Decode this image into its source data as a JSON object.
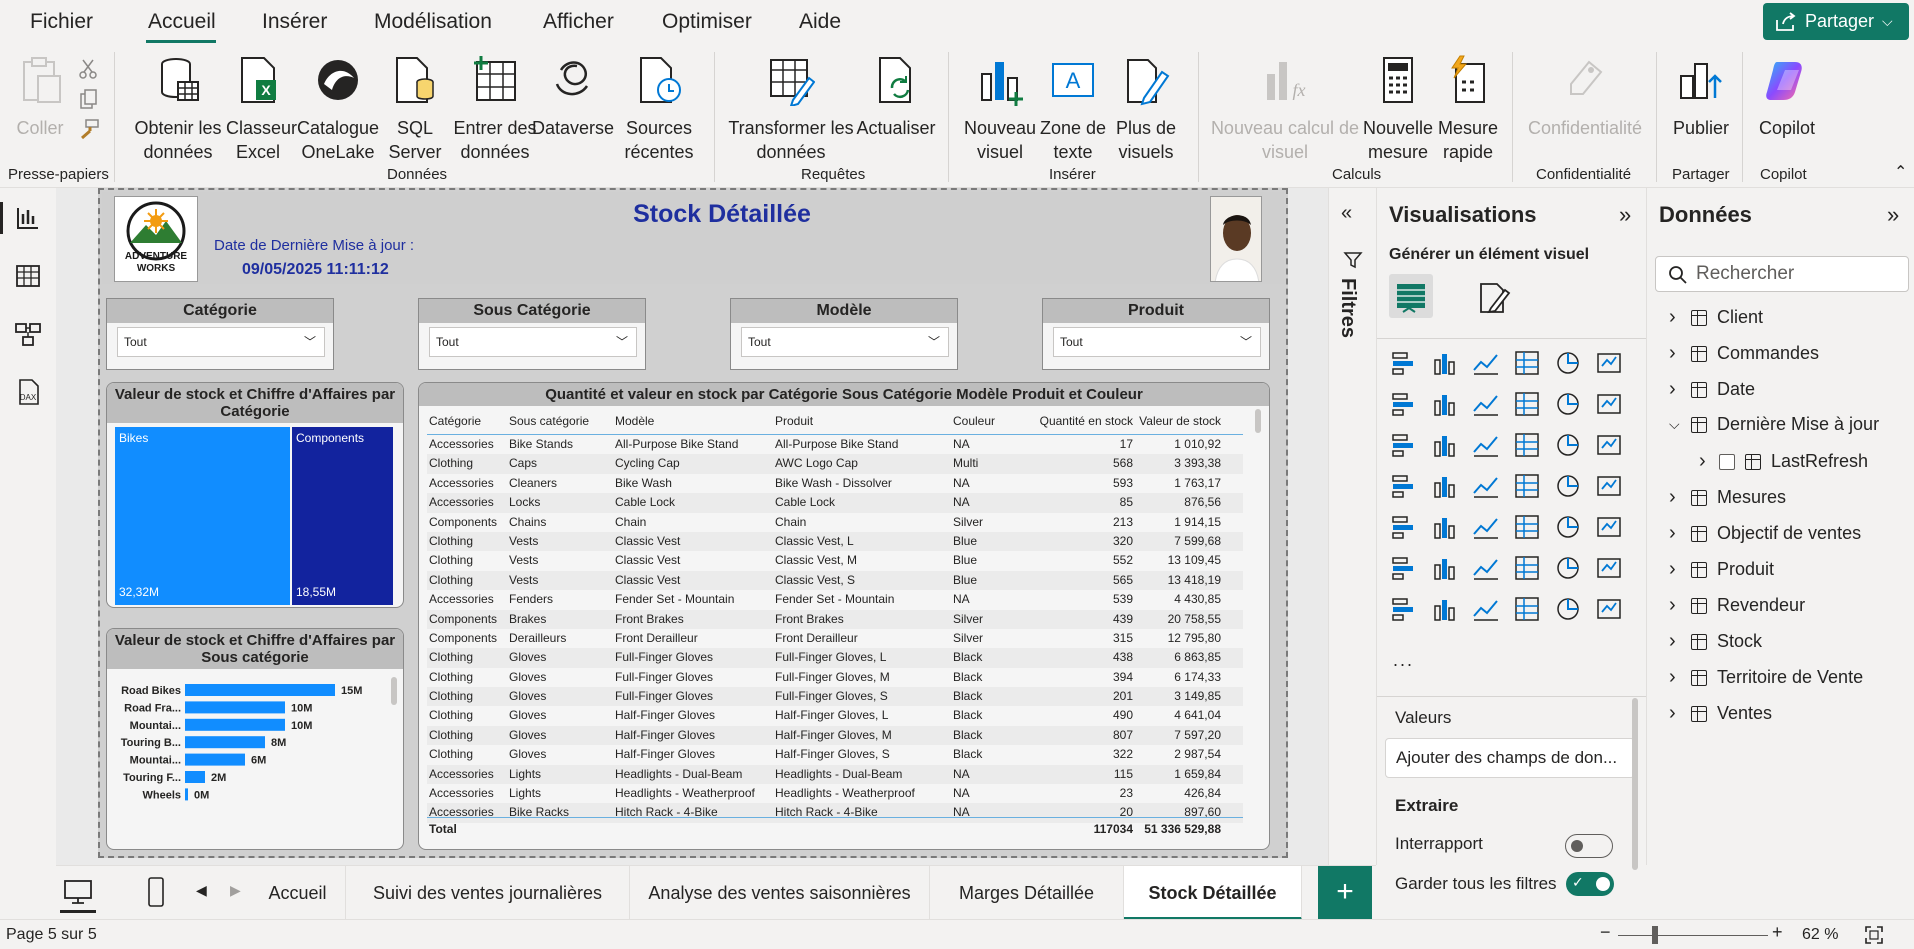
{
  "menu": {
    "items": [
      "Fichier",
      "Accueil",
      "Insérer",
      "Modélisation",
      "Afficher",
      "Optimiser",
      "Aide"
    ],
    "active": "Accueil",
    "share_label": "Partager"
  },
  "ribbon": {
    "clipboard": {
      "paste_label": "Coller",
      "group_label": "Presse-papiers"
    },
    "data": {
      "get_data_label": "Obtenir les données",
      "excel_label": "Classeur Excel",
      "onelake_label": "Catalogue OneLake",
      "sql_label": "SQL Server",
      "enter_data_label": "Entrer des données",
      "dataverse_label": "Dataverse",
      "recent_label": "Sources récentes",
      "group_label": "Données"
    },
    "queries": {
      "transform_label": "Transformer les données",
      "refresh_label": "Actualiser",
      "group_label": "Requêtes"
    },
    "insert": {
      "new_visual_label": "Nouveau visuel",
      "textbox_label": "Zone de texte",
      "more_visuals_label": "Plus de visuels",
      "group_label": "Insérer"
    },
    "calculations": {
      "new_calc_label": "Nouveau calcul de visuel",
      "new_measure_label": "Nouvelle mesure",
      "quick_measure_label": "Mesure rapide",
      "group_label": "Calculs"
    },
    "sensitivity": {
      "label": "Confidentialité",
      "group_label": "Confidentialité"
    },
    "share": {
      "publish_label": "Publier",
      "group_label": "Partager"
    },
    "copilot": {
      "label": "Copilot",
      "group_label": "Copilot"
    }
  },
  "report": {
    "title": "Stock Détaillée",
    "logo_text": "ADVENTURE WORKS",
    "last_update_label": "Date de Dernière Mise à jour :",
    "last_update_value": "09/05/2025 11:11:12",
    "slicers": [
      {
        "title": "Catégorie",
        "value": "Tout"
      },
      {
        "title": "Sous Catégorie",
        "value": "Tout"
      },
      {
        "title": "Modèle",
        "value": "Tout"
      },
      {
        "title": "Produit",
        "value": "Tout"
      }
    ],
    "treemap_title": "Valeur de stock et Chiffre d'Affaires par Catégorie",
    "barchart_title": "Valeur de stock et Chiffre d'Affaires par Sous catégorie",
    "table_title": "Quantité et valeur en stock par Catégorie Sous Catégorie Modèle Produit et Couleur",
    "table": {
      "headers": [
        "Catégorie",
        "Sous catégorie",
        "Modèle",
        "Produit",
        "Couleur",
        "Quantité en stock",
        "Valeur de stock"
      ],
      "rows": [
        [
          "Accessories",
          "Bike Stands",
          "All-Purpose Bike Stand",
          "All-Purpose Bike Stand",
          "NA",
          "17",
          "1 010,92"
        ],
        [
          "Clothing",
          "Caps",
          "Cycling Cap",
          "AWC Logo Cap",
          "Multi",
          "568",
          "3 393,38"
        ],
        [
          "Accessories",
          "Cleaners",
          "Bike Wash",
          "Bike Wash - Dissolver",
          "NA",
          "593",
          "1 763,17"
        ],
        [
          "Accessories",
          "Locks",
          "Cable Lock",
          "Cable Lock",
          "NA",
          "85",
          "876,56"
        ],
        [
          "Components",
          "Chains",
          "Chain",
          "Chain",
          "Silver",
          "213",
          "1 914,15"
        ],
        [
          "Clothing",
          "Vests",
          "Classic Vest",
          "Classic Vest, L",
          "Blue",
          "320",
          "7 599,68"
        ],
        [
          "Clothing",
          "Vests",
          "Classic Vest",
          "Classic Vest, M",
          "Blue",
          "552",
          "13 109,45"
        ],
        [
          "Clothing",
          "Vests",
          "Classic Vest",
          "Classic Vest, S",
          "Blue",
          "565",
          "13 418,19"
        ],
        [
          "Accessories",
          "Fenders",
          "Fender Set - Mountain",
          "Fender Set - Mountain",
          "NA",
          "539",
          "4 430,85"
        ],
        [
          "Components",
          "Brakes",
          "Front Brakes",
          "Front Brakes",
          "Silver",
          "439",
          "20 758,55"
        ],
        [
          "Components",
          "Derailleurs",
          "Front Derailleur",
          "Front Derailleur",
          "Silver",
          "315",
          "12 795,80"
        ],
        [
          "Clothing",
          "Gloves",
          "Full-Finger Gloves",
          "Full-Finger Gloves, L",
          "Black",
          "438",
          "6 863,85"
        ],
        [
          "Clothing",
          "Gloves",
          "Full-Finger Gloves",
          "Full-Finger Gloves, M",
          "Black",
          "394",
          "6 174,33"
        ],
        [
          "Clothing",
          "Gloves",
          "Full-Finger Gloves",
          "Full-Finger Gloves, S",
          "Black",
          "201",
          "3 149,85"
        ],
        [
          "Clothing",
          "Gloves",
          "Half-Finger Gloves",
          "Half-Finger Gloves, L",
          "Black",
          "490",
          "4 641,04"
        ],
        [
          "Clothing",
          "Gloves",
          "Half-Finger Gloves",
          "Half-Finger Gloves, M",
          "Black",
          "807",
          "7 597,20"
        ],
        [
          "Clothing",
          "Gloves",
          "Half-Finger Gloves",
          "Half-Finger Gloves, S",
          "Black",
          "322",
          "2 987,54"
        ],
        [
          "Accessories",
          "Lights",
          "Headlights - Dual-Beam",
          "Headlights - Dual-Beam",
          "NA",
          "115",
          "1 659,84"
        ],
        [
          "Accessories",
          "Lights",
          "Headlights - Weatherproof",
          "Headlights - Weatherproof",
          "NA",
          "23",
          "426,84"
        ],
        [
          "Accessories",
          "Bike Racks",
          "Hitch Rack - 4-Bike",
          "Hitch Rack - 4-Bike",
          "NA",
          "20",
          "897,60"
        ]
      ],
      "total_label": "Total",
      "total_qty": "117034",
      "total_value": "51 336 529,88"
    }
  },
  "chart_data": [
    {
      "type": "treemap",
      "title": "Valeur de stock et Chiffre d'Affaires par Catégorie",
      "categories": [
        "Bikes",
        "Components"
      ],
      "values": [
        32.32,
        18.55
      ],
      "value_labels": [
        "32,32M",
        "18,55M"
      ],
      "colors": [
        "#118dff",
        "#12239e"
      ]
    },
    {
      "type": "bar",
      "title": "Valeur de stock et Chiffre d'Affaires par Sous catégorie",
      "categories": [
        "Road Bikes",
        "Road Fra...",
        "Mountai...",
        "Touring B...",
        "Mountai...",
        "Touring F...",
        "Wheels"
      ],
      "values": [
        15,
        10,
        10,
        8,
        6,
        2,
        0
      ],
      "value_labels": [
        "15M",
        "10M",
        "10M",
        "8M",
        "6M",
        "2M",
        "0M"
      ],
      "color": "#118dff"
    }
  ],
  "panes": {
    "filters_label": "Filtres",
    "viz_title": "Visualisations",
    "viz_subtitle": "Générer un élément visuel",
    "values_label": "Valeurs",
    "add_fields_placeholder": "Ajouter des champs de don...",
    "drill_label": "Extraire",
    "cross_report_label": "Interrapport",
    "keep_filters_label": "Garder tous les filtres",
    "more_label": "...",
    "data_title": "Données",
    "search_placeholder": "Rechercher",
    "tables": [
      "Client",
      "Commandes",
      "Date",
      "Dernière Mise à jour",
      "Mesures",
      "Objectif de ventes",
      "Produit",
      "Revendeur",
      "Stock",
      "Territoire de Vente",
      "Ventes"
    ],
    "expanded_field": "LastRefresh"
  },
  "tabs": [
    "Accueil",
    "Suivi des ventes journalières",
    "Analyse des ventes saisonnières",
    "Marges Détaillée",
    "Stock Détaillée"
  ],
  "active_tab": "Stock Détaillée",
  "status": {
    "page": "Page 5 sur 5",
    "zoom": "62 %"
  }
}
